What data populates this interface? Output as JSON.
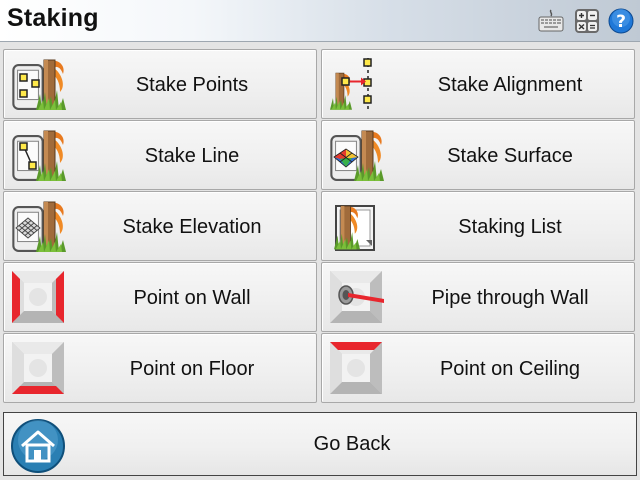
{
  "window": {
    "title": "Staking"
  },
  "toolbar": {
    "icons": [
      "keyboard-icon",
      "calculator-icon",
      "help-icon"
    ],
    "help_glyph": "?"
  },
  "menu": {
    "items": [
      {
        "label": "Stake Points",
        "icon": "stake-points-icon"
      },
      {
        "label": "Stake Alignment",
        "icon": "stake-alignment-icon"
      },
      {
        "label": "Stake Line",
        "icon": "stake-line-icon"
      },
      {
        "label": "Stake Surface",
        "icon": "stake-surface-icon"
      },
      {
        "label": "Stake Elevation",
        "icon": "stake-elevation-icon"
      },
      {
        "label": "Staking List",
        "icon": "staking-list-icon"
      },
      {
        "label": "Point on Wall",
        "icon": "point-on-wall-icon"
      },
      {
        "label": "Pipe through Wall",
        "icon": "pipe-through-wall-icon"
      },
      {
        "label": "Point on Floor",
        "icon": "point-on-floor-icon"
      },
      {
        "label": "Point on Ceiling",
        "icon": "point-on-ceiling-icon"
      }
    ]
  },
  "footer": {
    "go_back_label": "Go Back",
    "icon": "home-icon"
  },
  "colors": {
    "accent_red": "#e8262d",
    "marker_yellow": "#ffe94a",
    "help_blue": "#1f78d8",
    "home_teal": "#2a7fb3"
  }
}
